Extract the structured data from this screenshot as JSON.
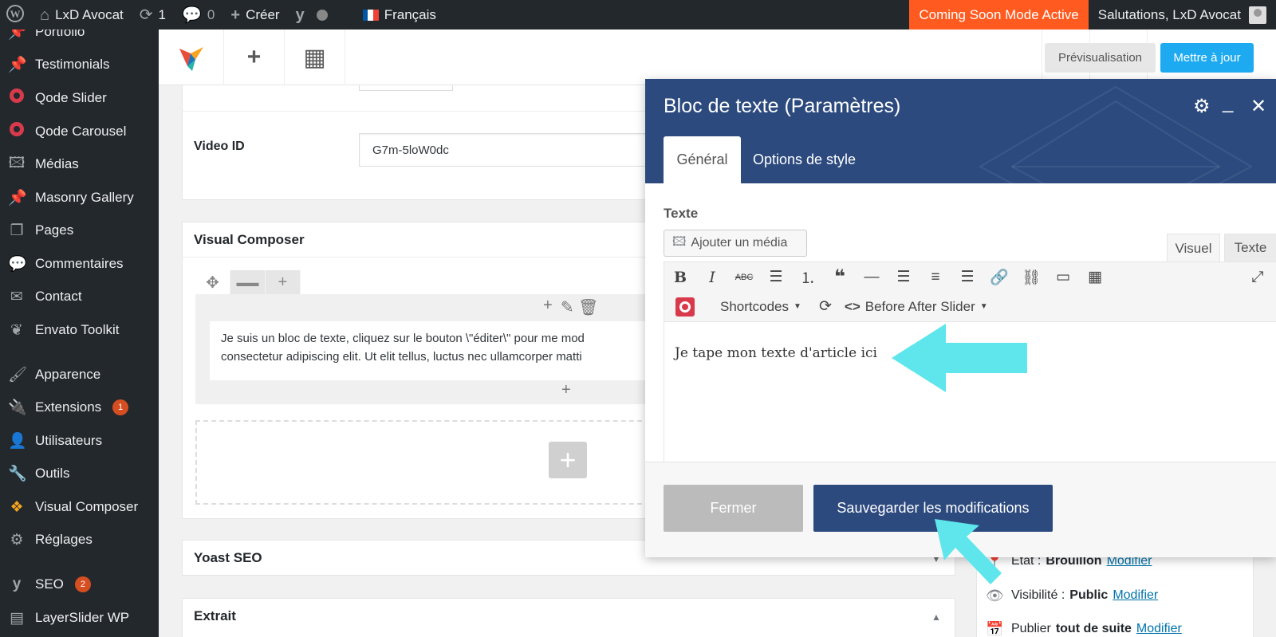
{
  "adminbar": {
    "site_name": "LxD Avocat",
    "updates_count": "1",
    "comments_count": "0",
    "new_label": "Créer",
    "language": "Français",
    "coming_soon": "Coming Soon Mode Active",
    "greeting": "Salutations, LxD Avocat",
    "coming_soon_color": "#ff5a1f"
  },
  "sidebar": {
    "items": [
      {
        "label": "Portfolio",
        "icon": "pin-icon"
      },
      {
        "label": "Testimonials",
        "icon": "pin-icon"
      },
      {
        "label": "Qode Slider",
        "icon": "qode-icon"
      },
      {
        "label": "Qode Carousel",
        "icon": "qode-icon"
      },
      {
        "label": "Médias",
        "icon": "media-icon"
      },
      {
        "label": "Masonry Gallery",
        "icon": "pin-icon"
      },
      {
        "label": "Pages",
        "icon": "pages-icon"
      },
      {
        "label": "Commentaires",
        "icon": "comment-icon"
      },
      {
        "label": "Contact",
        "icon": "mail-icon"
      },
      {
        "label": "Envato Toolkit",
        "icon": "leaf-icon"
      },
      {
        "label": "Apparence",
        "icon": "brush-icon"
      },
      {
        "label": "Extensions",
        "icon": "plugin-icon",
        "badge": "1"
      },
      {
        "label": "Utilisateurs",
        "icon": "user-icon"
      },
      {
        "label": "Outils",
        "icon": "wrench-icon"
      },
      {
        "label": "Visual Composer",
        "icon": "vc-icon"
      },
      {
        "label": "Réglages",
        "icon": "settings-icon"
      },
      {
        "label": "SEO",
        "icon": "yoast-icon",
        "badge": "2"
      },
      {
        "label": "LayerSlider WP",
        "icon": "layers-icon"
      }
    ]
  },
  "toolbar": {
    "preview": "Prévisualisation",
    "update": "Mettre à jour",
    "update_color": "#1eaaf1"
  },
  "main": {
    "video_id_label": "Video ID",
    "video_id_value": "G7m-5loW0dc",
    "vc_title": "Visual Composer",
    "text_block_line1": "Je suis un bloc de texte, cliquez sur le bouton \\\"éditer\\\" pour me mod",
    "text_block_line2": "consectetur adipiscing elit. Ut elit tellus, luctus nec ullamcorper matti",
    "yoast_title": "Yoast SEO",
    "extrait_title": "Extrait"
  },
  "publish": {
    "etat_label": "État :",
    "etat_value": "Brouillon",
    "visibility_label": "Visibilité :",
    "visibility_value": "Public",
    "publish_label": "Publier",
    "publish_value": "tout de suite",
    "modify": "Modifier"
  },
  "modal": {
    "title": "Bloc de texte (Paramètres)",
    "tab_general": "Général",
    "tab_style": "Options de style",
    "field_label": "Texte",
    "add_media": "Ajouter un média",
    "tab_visuel": "Visuel",
    "tab_texte": "Texte",
    "shortcodes": "Shortcodes",
    "before_after": "Before After Slider",
    "content": "Je tape mon texte d'article ici",
    "close": "Fermer",
    "save": "Sauvegarder les modifications",
    "header_color": "#2c4a7e"
  }
}
